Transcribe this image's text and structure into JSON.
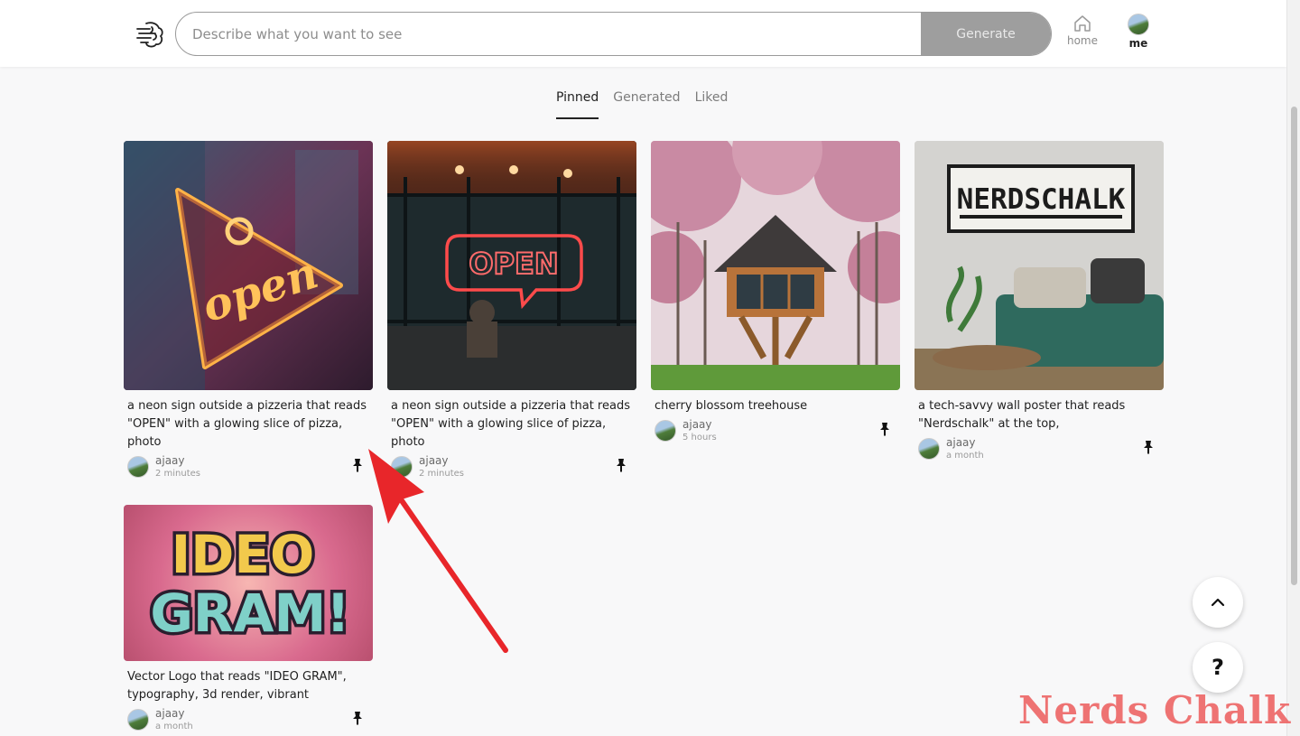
{
  "header": {
    "search_placeholder": "Describe what you want to see",
    "generate_label": "Generate",
    "home_label": "home",
    "me_label": "me"
  },
  "tabs": [
    {
      "label": "Pinned",
      "active": true
    },
    {
      "label": "Generated",
      "active": false
    },
    {
      "label": "Liked",
      "active": false
    }
  ],
  "cards": [
    {
      "caption": "a neon sign outside a pizzeria that reads \"OPEN\" with a glowing slice of pizza, photo",
      "user": "ajaay",
      "time": "2 minutes",
      "image": "neon-pizza-open-sign"
    },
    {
      "caption": "a neon sign outside a pizzeria that reads \"OPEN\" with a glowing slice of pizza, photo",
      "user": "ajaay",
      "time": "2 minutes",
      "image": "neon-open-sign-window"
    },
    {
      "caption": "cherry blossom treehouse",
      "user": "ajaay",
      "time": "5 hours",
      "image": "cherry-blossom-treehouse"
    },
    {
      "caption": "a tech-savvy wall poster that reads \"Nerdschalk\" at the top,",
      "user": "ajaay",
      "time": "a month",
      "image": "nerdschalk-wall-poster"
    },
    {
      "caption": "Vector Logo that reads \"IDEO GRAM\", typography, 3d render, vibrant",
      "user": "ajaay",
      "time": "a month",
      "image": "ideogram-logo"
    }
  ],
  "image_text": {
    "open_script": "open",
    "open_sign": "OPEN",
    "poster": "NERDSCHALK",
    "logo_line1": "IDEO",
    "logo_line2": "GRAM!"
  },
  "floating": {
    "help_label": "?"
  },
  "watermark": "Nerds Chalk",
  "colors": {
    "accent_arrow": "#e8262a",
    "generate_bg": "#9e9e9e",
    "active_tab": "#222222"
  }
}
